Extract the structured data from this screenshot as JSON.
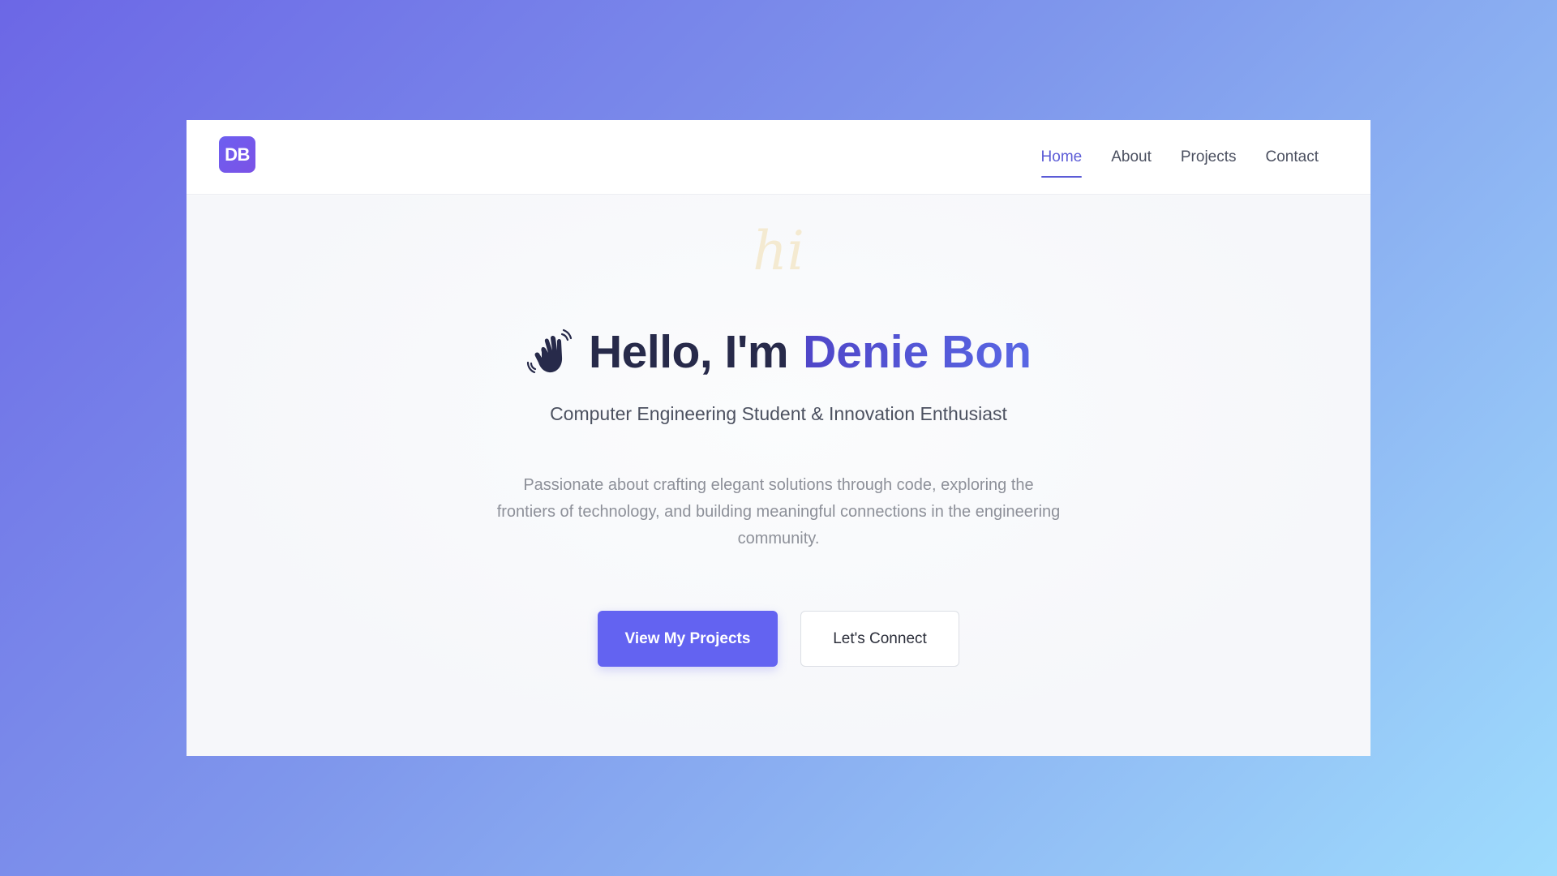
{
  "header": {
    "logo_text": "DB",
    "nav": [
      {
        "label": "Home",
        "active": true
      },
      {
        "label": "About",
        "active": false
      },
      {
        "label": "Projects",
        "active": false
      },
      {
        "label": "Contact",
        "active": false
      }
    ]
  },
  "hero": {
    "script_text": "hi",
    "wave_icon": "waving-hand-icon",
    "greeting": "Hello, I'm",
    "name": "Denie Bon",
    "subtitle": "Computer Engineering Student & Innovation Enthusiast",
    "intro": "Passionate about crafting elegant solutions through code, exploring the frontiers of technology, and building meaningful connections in the engineering community.",
    "primary_button": "View My Projects",
    "secondary_button": "Let's Connect"
  },
  "colors": {
    "accent": "#6363f1",
    "nav_active": "#5b5bd6",
    "heading": "#272a4a"
  }
}
